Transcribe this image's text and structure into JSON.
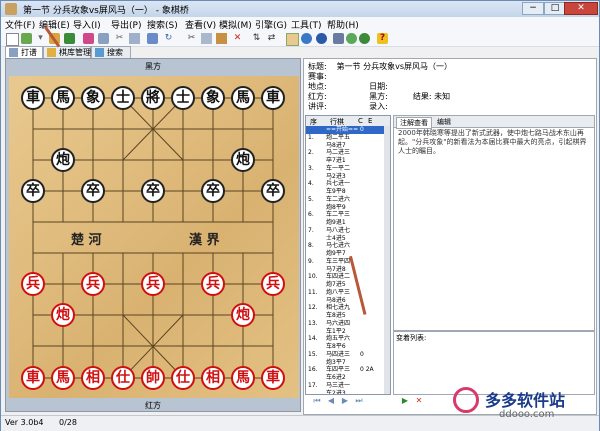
{
  "window": {
    "title": "第一节  分兵攻象vs屏风马（一） - 象棋桥",
    "min": "−",
    "max": "□",
    "close": "✕"
  },
  "menu": [
    "文件(F)",
    "编辑(E)",
    "导入(I)",
    "导出(P)",
    "搜索(S)",
    "查看(V)",
    "模拟(M)",
    "引擎(G)",
    "工具(T)",
    "帮助(H)"
  ],
  "toolbar_icons": [
    "new-icon",
    "open-icon",
    "open-dropdown-icon",
    "save-icon",
    "print-icon",
    "save-as-icon",
    "preview-icon",
    "cut-icon",
    "copy-icon",
    "paste-icon",
    "delete-icon",
    "undo-icon",
    "redo-icon",
    "flip-v-icon",
    "flip-h-icon",
    "board-icon",
    "engine-icon",
    "play-icon",
    "stop-icon",
    "book-icon",
    "book2-icon",
    "help-icon"
  ],
  "tabs": [
    {
      "label": "打谱",
      "active": true
    },
    {
      "label": "棋库管理",
      "active": false
    },
    {
      "label": "搜索",
      "active": false
    }
  ],
  "board": {
    "top_player": "黑方",
    "bottom_player": "红方",
    "river_left": "楚  河",
    "river_right": "漢  界",
    "black_back": [
      "車",
      "馬",
      "象",
      "士",
      "將",
      "士",
      "象",
      "馬",
      "車"
    ],
    "black_cannon": "炮",
    "black_pawn": "卒",
    "red_back": [
      "車",
      "馬",
      "相",
      "仕",
      "帥",
      "仕",
      "相",
      "馬",
      "車"
    ],
    "red_cannon": "炮",
    "red_pawn": "兵"
  },
  "info": {
    "title_label": "标题:",
    "title": "第一节  分兵攻象vs屏风马（一）",
    "event_label": "赛事:",
    "event": "",
    "place_label": "地点:",
    "place": "",
    "date_label": "日期:",
    "date": "",
    "red_label": "红方:",
    "red": "",
    "black_label": "黑方:",
    "black": "",
    "result_label": "结果:",
    "result": "未知",
    "commentator_label": "讲评:",
    "commentator": "",
    "entry_label": "录入:",
    "entry": ""
  },
  "movelist": {
    "col_seq": "序",
    "col_move": "行棋",
    "col_c": "C",
    "col_e": "E",
    "rows": [
      {
        "n": "",
        "m": "==开始==",
        "e": "0",
        "sel": true
      },
      {
        "n": "1.",
        "m": "炮二平五",
        "e": ""
      },
      {
        "n": "",
        "m": "马8进7",
        "e": ""
      },
      {
        "n": "2.",
        "m": "马二进三",
        "e": ""
      },
      {
        "n": "",
        "m": "卒7进1",
        "e": ""
      },
      {
        "n": "3.",
        "m": "车一平二",
        "e": ""
      },
      {
        "n": "",
        "m": "马2进3",
        "e": ""
      },
      {
        "n": "4.",
        "m": "兵七进一",
        "e": ""
      },
      {
        "n": "",
        "m": "车9平8",
        "e": ""
      },
      {
        "n": "5.",
        "m": "车二进六",
        "e": ""
      },
      {
        "n": "",
        "m": "炮8平9",
        "e": ""
      },
      {
        "n": "6.",
        "m": "车二平三",
        "e": ""
      },
      {
        "n": "",
        "m": "炮9退1",
        "e": ""
      },
      {
        "n": "7.",
        "m": "马八进七",
        "e": ""
      },
      {
        "n": "",
        "m": "士4进5",
        "e": ""
      },
      {
        "n": "8.",
        "m": "马七进六",
        "e": ""
      },
      {
        "n": "",
        "m": "炮9平7",
        "e": ""
      },
      {
        "n": "9.",
        "m": "车三平四",
        "e": ""
      },
      {
        "n": "",
        "m": "马7进8",
        "e": ""
      },
      {
        "n": "10.",
        "m": "车四进二",
        "e": ""
      },
      {
        "n": "",
        "m": "炮7进5",
        "e": ""
      },
      {
        "n": "11.",
        "m": "炮八平三",
        "e": ""
      },
      {
        "n": "",
        "m": "马8进6",
        "e": ""
      },
      {
        "n": "12.",
        "m": "相七进九",
        "e": ""
      },
      {
        "n": "",
        "m": "车8进5",
        "e": ""
      },
      {
        "n": "13.",
        "m": "马六进四",
        "e": ""
      },
      {
        "n": "",
        "m": "车1平2",
        "e": ""
      },
      {
        "n": "14.",
        "m": "炮五平六",
        "e": ""
      },
      {
        "n": "",
        "m": "车8平6",
        "e": ""
      },
      {
        "n": "15.",
        "m": "马四进三",
        "e": "0"
      },
      {
        "n": "",
        "m": "炮3平7",
        "e": ""
      },
      {
        "n": "16.",
        "m": "车四平三",
        "e": "0 2A"
      },
      {
        "n": "",
        "m": "车6进2",
        "e": ""
      },
      {
        "n": "17.",
        "m": "马三进一",
        "e": ""
      },
      {
        "n": "",
        "m": "车2进3",
        "e": ""
      }
    ]
  },
  "comments": {
    "tab1": "注解查看",
    "tab2": "编辑",
    "text": "2000年韩晓寒等提出了新式武器，使中炮七路马战术东山再起。\"分兵攻象\"的新看法为本届比赛中最大的亮点，引起棋界人士的瞩目。",
    "variations_label": "变着列表:"
  },
  "status": {
    "version": "Ver 3.0b4",
    "position": "0/28"
  },
  "watermark": {
    "text": "多多软件站",
    "url": "ddooo.com"
  }
}
